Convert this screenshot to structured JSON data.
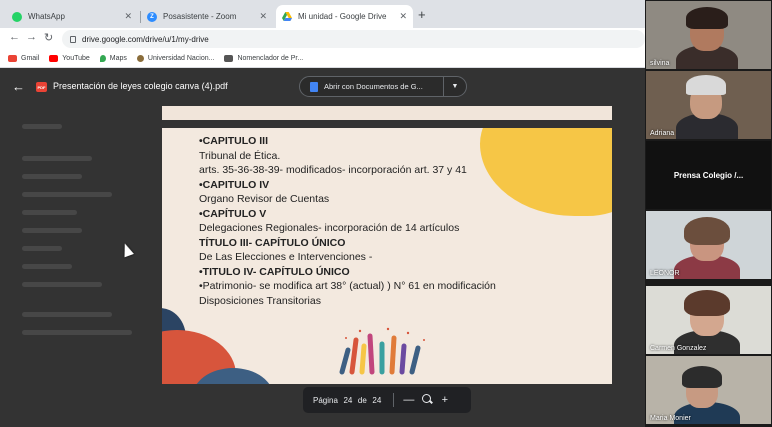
{
  "browser": {
    "tabs": [
      {
        "title": "WhatsApp",
        "icon": "whatsapp-icon",
        "color": "#25d366"
      },
      {
        "title": "Posasistente - Zoom",
        "icon": "zoom-icon",
        "color": "#2d8cff"
      },
      {
        "title": "Mi unidad - Google Drive",
        "icon": "drive-icon",
        "color": "#34a853"
      }
    ],
    "url": "drive.google.com/drive/u/1/my-drive",
    "bookmarks": [
      {
        "label": "Gmail",
        "color": "#ea4335"
      },
      {
        "label": "YouTube",
        "color": "#ff0000"
      },
      {
        "label": "Maps",
        "color": "#34a853"
      },
      {
        "label": "Universidad Nacion...",
        "color": "#8a6d3b"
      },
      {
        "label": "Nomenclador de Pr...",
        "color": "#555555"
      }
    ]
  },
  "viewer": {
    "title": "Presentación de leyes colegio canva (4).pdf",
    "open_with": "Abrir con Documentos de G...",
    "pdf_badge": "PDF"
  },
  "slide": {
    "lines": [
      {
        "text": "•CAPITULO III",
        "bold": true
      },
      {
        "text": "Tribunal de Ética.",
        "bold": false
      },
      {
        "text": " arts. 35-36-38-39- modificados- incorporación art. 37 y 41",
        "bold": false
      },
      {
        "text": "•CAPITULO IV",
        "bold": true
      },
      {
        "text": "Organo Revisor de Cuentas",
        "bold": false
      },
      {
        "text": "•CAPÍTULO V",
        "bold": true
      },
      {
        "text": " Delegaciones Regionales- incorporación de 14 artículos",
        "bold": false
      },
      {
        "text": "TÍTULO III- CAPÍTULO ÚNICO",
        "bold": true
      },
      {
        "text": "De Las Elecciones e Intervenciones -",
        "bold": false
      },
      {
        "text": "•TITULO IV- CAPÍTULO ÚNICO",
        "bold": true
      },
      {
        "text": "•Patrimonio- se modifica art 38° (actual) ) N° 61 en modificación",
        "bold": false
      },
      {
        "text": "Disposiciones Transitorias",
        "bold": false
      }
    ]
  },
  "pager": {
    "label": "Página",
    "current": "24",
    "of": "de",
    "total": "24",
    "zoom_out": "—",
    "zoom_in": "+"
  },
  "participants": [
    {
      "name": "silvina"
    },
    {
      "name": "Adriana"
    },
    {
      "name": "Prensa Colegio /..."
    },
    {
      "name": "LEONOR"
    },
    {
      "name": "Carmen Gonzalez"
    },
    {
      "name": "Maria Monier"
    }
  ]
}
